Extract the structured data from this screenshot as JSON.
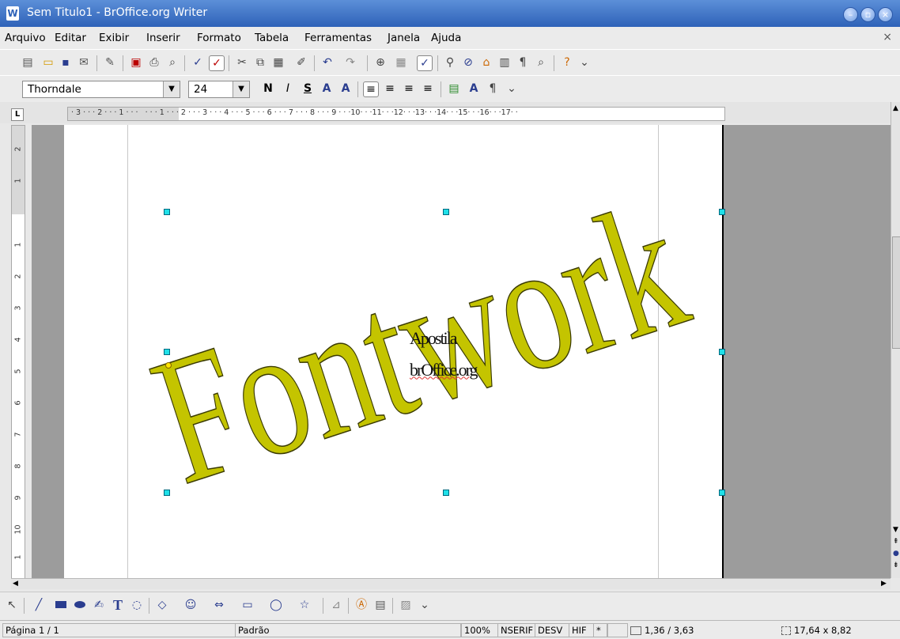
{
  "window": {
    "title": "Sem Titulo1 - BrOffice.org Writer",
    "app_icon_glyph": "W"
  },
  "menu": [
    {
      "label": "Arquivo"
    },
    {
      "label": "Editar"
    },
    {
      "label": "Exibir"
    },
    {
      "label": "Inserir"
    },
    {
      "label": "Formato"
    },
    {
      "label": "Tabela"
    },
    {
      "label": "Ferramentas"
    },
    {
      "label": "Janela"
    },
    {
      "label": "Ajuda"
    }
  ],
  "formatting": {
    "font_name": "Thorndale",
    "font_size": "24",
    "bold_label": "N",
    "italic_label": "I",
    "underline_label": "S"
  },
  "ruler": {
    "horizontal": "· 3 · · · 2 · · · 1 · · ·   · · · 1 · · · 2 · · · 3 · · · 4 · · · 5 · · · 6 · · · 7 · · · 8 · · · 9 · · ·10· · ·11· · ·12· · ·13· · ·14· · ·15· · ·16· · ·17· ·",
    "vertical_labels": [
      "2",
      "1",
      "1",
      "2",
      "3",
      "4",
      "5",
      "6",
      "7",
      "8",
      "9",
      "10",
      "1"
    ]
  },
  "document": {
    "fontwork_text": "Fontwork",
    "textbox_line1": "Apostila",
    "textbox_line2": "brOffice.org",
    "fontwork_color": "#c4c400"
  },
  "status": {
    "page": "Página 1 / 1",
    "style": "Padrão",
    "zoom": "100%",
    "insert_mode": "NSERIF",
    "selection_mode": "DESV",
    "hyperlink_mode": "HIF",
    "modified": "*",
    "position": "1,36 / 3,63",
    "size": "17,64 x 8,82"
  }
}
